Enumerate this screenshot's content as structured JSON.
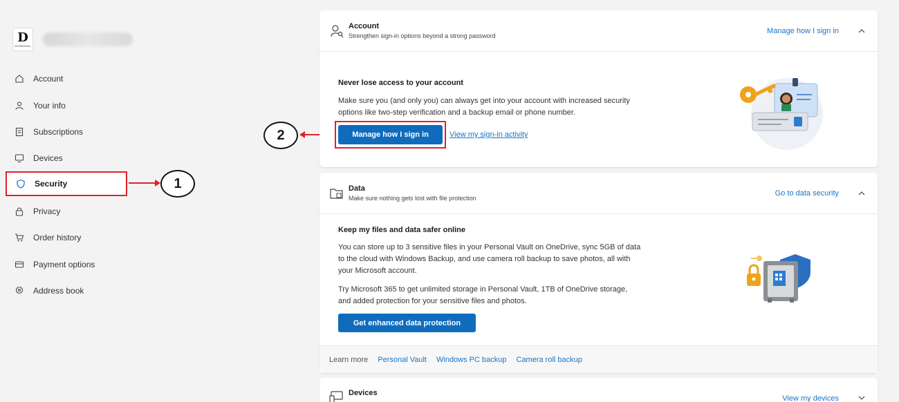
{
  "sidebar": {
    "items": [
      {
        "label": "Account",
        "icon": "home-icon"
      },
      {
        "label": "Your info",
        "icon": "person-icon"
      },
      {
        "label": "Subscriptions",
        "icon": "receipt-icon"
      },
      {
        "label": "Devices",
        "icon": "monitor-icon"
      },
      {
        "label": "Security",
        "icon": "shield-icon"
      },
      {
        "label": "Privacy",
        "icon": "lock-icon"
      },
      {
        "label": "Order history",
        "icon": "cart-icon"
      },
      {
        "label": "Payment options",
        "icon": "card-icon"
      },
      {
        "label": "Address book",
        "icon": "location-icon"
      }
    ],
    "logo_mark": "D",
    "logo_word": "DIGINODAL"
  },
  "annotations": {
    "one": "1",
    "two": "2"
  },
  "account_card": {
    "title": "Account",
    "subtitle": "Strengthen sign-in options beyond a strong password",
    "header_link": "Manage how I sign in",
    "body_title": "Never lose access to your account",
    "body_text": "Make sure you (and only you) can always get into your account with increased security options like two-step verification and a backup email or phone number.",
    "primary_button": "Manage how I sign in",
    "secondary_link": "View my sign-in activity"
  },
  "data_card": {
    "title": "Data",
    "subtitle": "Make sure nothing gets lost with file protection",
    "header_link": "Go to data security",
    "body_title": "Keep my files and data safer online",
    "para1": "You can store up to 3 sensitive files in your Personal Vault on OneDrive, sync 5GB of data to the cloud with Windows Backup, and use camera roll backup to save photos, all with your Microsoft account.",
    "para2": "Try Microsoft 365 to get unlimited storage in Personal Vault, 1TB of OneDrive storage, and added protection for your sensitive files and photos.",
    "primary_button": "Get enhanced data protection",
    "learn_more": "Learn more",
    "footer_links": [
      "Personal Vault",
      "Windows PC backup",
      "Camera roll backup"
    ]
  },
  "devices_card": {
    "title": "Devices",
    "header_link": "View my devices"
  },
  "colors": {
    "accent": "#0f6cbd",
    "highlight": "#e0202a",
    "link": "#1a73c8"
  }
}
